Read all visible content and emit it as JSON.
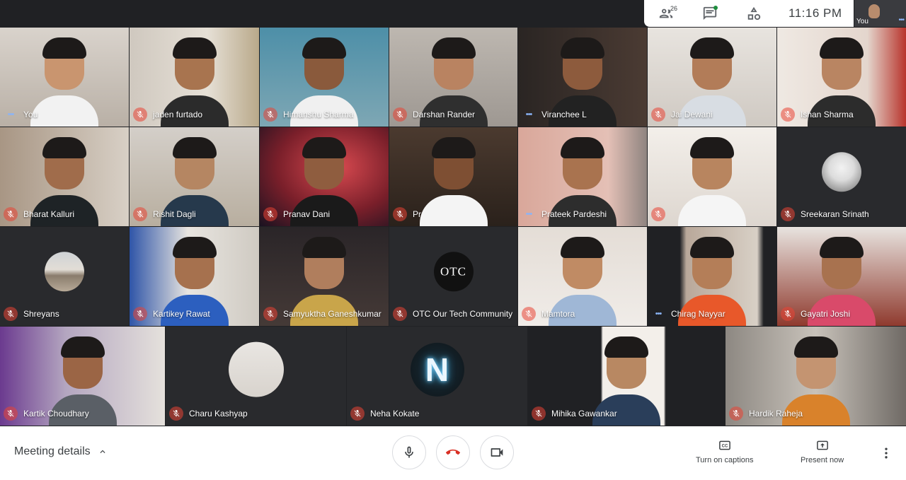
{
  "top_bar": {
    "people_count": "26",
    "clock": "11:16 PM",
    "self_label": "You"
  },
  "participants": [
    {
      "name": "You",
      "muted": false
    },
    {
      "name": "jaden furtado",
      "muted": true
    },
    {
      "name": "Himanshu Sharma",
      "muted": true
    },
    {
      "name": "Darshan Rander",
      "muted": true
    },
    {
      "name": "Viranchee L",
      "muted": false,
      "speaking": true
    },
    {
      "name": "Jai Dewani",
      "muted": true
    },
    {
      "name": "Ishan Sharma",
      "muted": true
    },
    {
      "name": "Bharat Kalluri",
      "muted": true
    },
    {
      "name": "Rishit Dagli",
      "muted": true
    },
    {
      "name": "Pranav Dani",
      "muted": true
    },
    {
      "name": "Pr",
      "muted": true
    },
    {
      "name": "Prateek Pardeshi",
      "muted": false
    },
    {
      "name": "",
      "muted": true
    },
    {
      "name": "Sreekaran Srinath",
      "muted": true
    },
    {
      "name": "Shreyans",
      "muted": true
    },
    {
      "name": "Kartikey Rawat",
      "muted": true
    },
    {
      "name": "Samyuktha Ganeshkumar",
      "muted": true
    },
    {
      "name": "OTC Our Tech Community",
      "muted": true
    },
    {
      "name": "Mamtora",
      "muted": true
    },
    {
      "name": "Chirag Nayyar",
      "muted": false
    },
    {
      "name": "Gayatri Joshi",
      "muted": true
    },
    {
      "name": "Kartik Choudhary",
      "muted": true
    },
    {
      "name": "Charu Kashyap",
      "muted": true
    },
    {
      "name": "Neha Kokate",
      "muted": true
    },
    {
      "name": "Mihika Gawankar",
      "muted": true
    },
    {
      "name": "Hardik Raheja",
      "muted": true
    }
  ],
  "avatars": {
    "otc_text": "OTC",
    "neha_letter": "N"
  },
  "bottom_bar": {
    "meeting_details": "Meeting details",
    "captions_label": "Turn on captions",
    "captions_icon_text": "CC",
    "present_label": "Present now"
  },
  "colors": {
    "background": "#202124",
    "mute_red": "#ea4335",
    "speaking_green": "#34a853",
    "accent_blue": "#8ab4f8",
    "end_call_red": "#d93025"
  }
}
